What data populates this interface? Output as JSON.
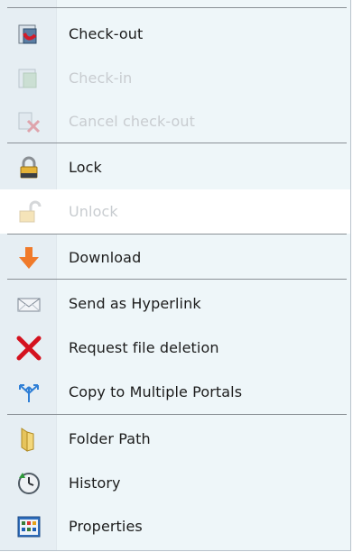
{
  "menu": {
    "items": [
      {
        "label": "Check-out",
        "icon": "checkout-icon",
        "enabled": true
      },
      {
        "label": "Check-in",
        "icon": "checkin-icon",
        "enabled": false
      },
      {
        "label": "Cancel check-out",
        "icon": "cancel-checkout-icon",
        "enabled": false
      },
      {
        "label": "Lock",
        "icon": "lock-icon",
        "enabled": true
      },
      {
        "label": "Unlock",
        "icon": "unlock-icon",
        "enabled": false
      },
      {
        "label": "Download",
        "icon": "download-arrow-icon",
        "enabled": true
      },
      {
        "label": "Send as Hyperlink",
        "icon": "envelope-icon",
        "enabled": true
      },
      {
        "label": "Request file deletion",
        "icon": "red-x-icon",
        "enabled": true
      },
      {
        "label": "Copy to Multiple Portals",
        "icon": "multi-arrow-icon",
        "enabled": true
      },
      {
        "label": "Folder Path",
        "icon": "folder-icon",
        "enabled": true
      },
      {
        "label": "History",
        "icon": "clock-icon",
        "enabled": true
      },
      {
        "label": "Properties",
        "icon": "properties-grid-icon",
        "enabled": true
      }
    ]
  }
}
